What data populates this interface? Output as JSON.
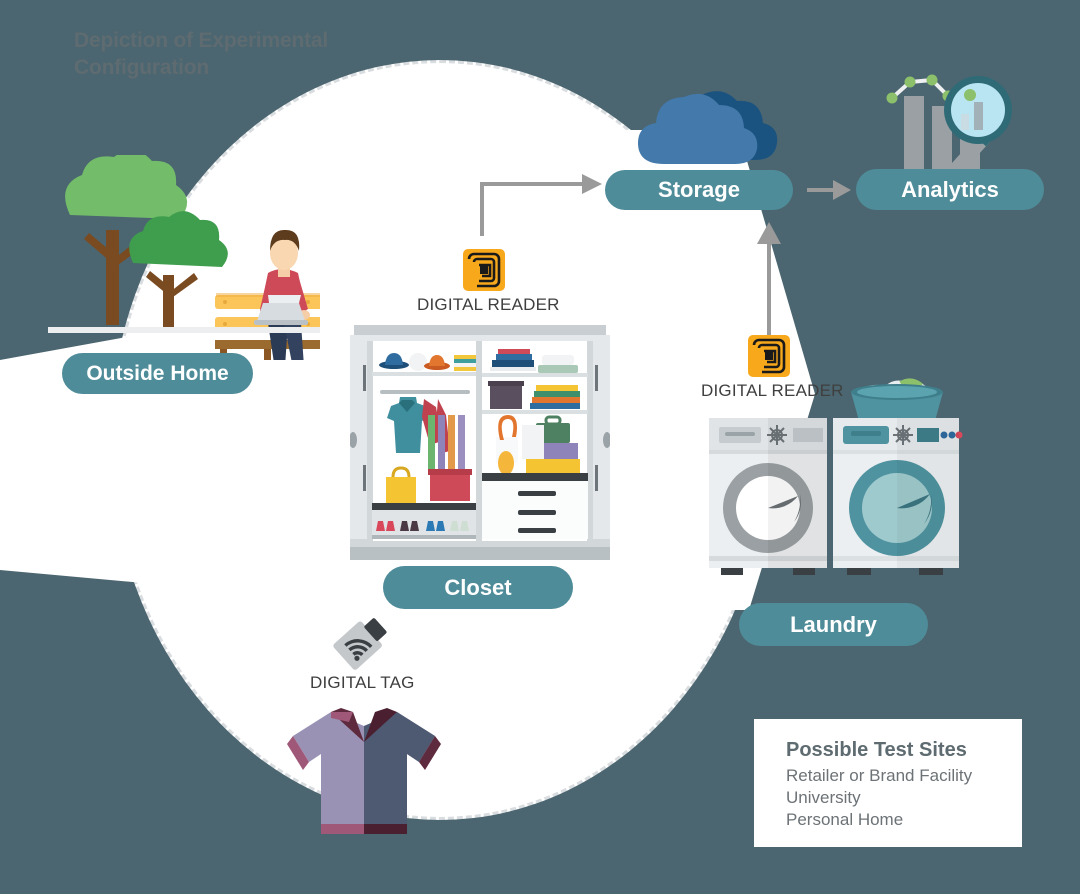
{
  "title": "Depiction of Experimental Configuration",
  "nodes": {
    "outside_home": "Outside Home",
    "closet": "Closet",
    "laundry": "Laundry",
    "storage": "Storage",
    "analytics": "Analytics"
  },
  "labels": {
    "reader_top": "DIGITAL READER",
    "reader_right": "DIGITAL READER",
    "tag": "DIGITAL TAG"
  },
  "legend": {
    "heading": "Possible Test Sites",
    "items": [
      "Retailer or Brand Facility",
      "University",
      "Personal Home"
    ]
  },
  "icons": {
    "reader": "rfid-reader-icon",
    "tag": "rfid-tag-icon",
    "cloud": "cloud-storage-icon",
    "analytics": "bar-chart-magnifier-icon",
    "shirt": "polo-shirt-icon",
    "closet": "closet-wardrobe-icon",
    "laundry": "washing-machine-icon",
    "park": "park-bench-person-laptop-icon"
  },
  "colors": {
    "background": "#4b6670",
    "pill": "#4f8c99",
    "accent_orange": "#f7a81b",
    "arrow_gray": "#9a9a9a",
    "title_gray": "#5e6b70",
    "cloud_front": "#4379ab",
    "cloud_back": "#1b5380",
    "panel_white": "#ffffff"
  }
}
